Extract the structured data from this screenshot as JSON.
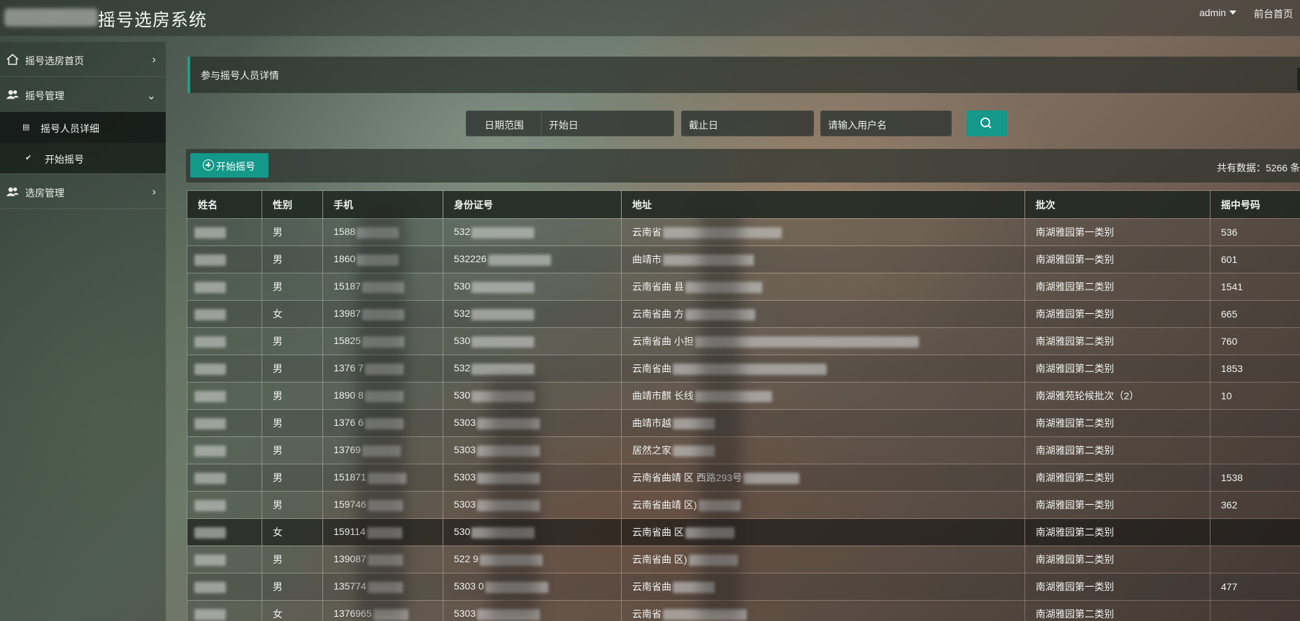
{
  "header": {
    "title": "摇号选房系统",
    "user_label": "admin",
    "home_link": "前台首页"
  },
  "sidebar": {
    "items": [
      {
        "label": "摇号选房首页",
        "icon": "home-icon",
        "chevron": "›"
      },
      {
        "label": "摇号管理",
        "icon": "users-icon",
        "chevron": "⌄"
      },
      {
        "label": "选房管理",
        "icon": "users-icon",
        "chevron": "›"
      }
    ],
    "subitems": [
      {
        "label": "摇号人员详细",
        "icon": "table-icon",
        "glyph": "▤"
      },
      {
        "label": "开始摇号",
        "icon": "check-icon",
        "glyph": "✔"
      }
    ]
  },
  "panel": {
    "title": "参与摇号人员详情"
  },
  "search": {
    "date_range_label": "日期范围",
    "start_placeholder": "开始日",
    "end_placeholder": "截止日",
    "user_placeholder": "请输入用户名"
  },
  "actions": {
    "start_label": "开始摇号",
    "total_text": "共有数据：5266 条"
  },
  "table": {
    "columns": [
      "姓名",
      "性别",
      "手机",
      "身份证号",
      "地址",
      "批次",
      "摇中号码"
    ],
    "rows": [
      {
        "gender": "男",
        "phone": "1588",
        "id": "532",
        "address": "云南省",
        "batch": "南湖雅园第一类别",
        "number": "536"
      },
      {
        "gender": "男",
        "phone": "1860",
        "id": "532226",
        "address": "曲靖市",
        "batch": "南湖雅园第一类别",
        "number": "601"
      },
      {
        "gender": "男",
        "phone": "15187",
        "id": "530",
        "address": "云南省曲    县",
        "batch": "南湖雅园第二类别",
        "number": "1541"
      },
      {
        "gender": "女",
        "phone": "13987",
        "id": "532",
        "address": "云南省曲    方",
        "batch": "南湖雅园第一类别",
        "number": "665"
      },
      {
        "gender": "男",
        "phone": "15825",
        "id": "530",
        "address": "云南省曲    小担",
        "batch": "南湖雅园第二类别",
        "number": "760"
      },
      {
        "gender": "男",
        "phone": "1376  7",
        "id": "532",
        "address": "云南省曲",
        "batch": "南湖雅园第二类别",
        "number": "1853"
      },
      {
        "gender": "男",
        "phone": "1890  8",
        "id": "530",
        "address": "曲靖市麒    长线",
        "batch": "南湖雅苑轮候批次（2）",
        "number": "10"
      },
      {
        "gender": "男",
        "phone": "1376  6",
        "id": "5303",
        "address": "曲靖市越",
        "batch": "南湖雅园第二类别",
        "number": ""
      },
      {
        "gender": "男",
        "phone": "13769",
        "id": "5303",
        "address": "居然之家",
        "batch": "南湖雅园第二类别",
        "number": ""
      },
      {
        "gender": "男",
        "phone": "151871",
        "id": "5303",
        "address": "云南省曲靖    区    西路293号",
        "batch": "南湖雅园第二类别",
        "number": "1538"
      },
      {
        "gender": "男",
        "phone": "159746",
        "id": "5303",
        "address": "云南省曲靖    区)",
        "batch": "南湖雅园第一类别",
        "number": "362"
      },
      {
        "gender": "女",
        "phone": "159114",
        "id": "530",
        "address": "云南省曲    区",
        "batch": "南湖雅园第二类别",
        "number": ""
      },
      {
        "gender": "男",
        "phone": "139087",
        "id": "522    9",
        "address": "云南省曲    区)",
        "batch": "南湖雅园第二类别",
        "number": ""
      },
      {
        "gender": "男",
        "phone": "135774",
        "id": "5303    0",
        "address": "云南省曲",
        "batch": "南湖雅园第一类别",
        "number": "477"
      },
      {
        "gender": "女",
        "phone": "1376965",
        "id": "5303",
        "address": "云南省",
        "batch": "南湖雅园第二类别",
        "number": ""
      }
    ]
  }
}
